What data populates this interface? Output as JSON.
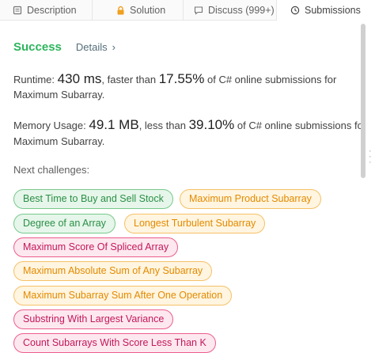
{
  "tabs": {
    "description": "Description",
    "solution": "Solution",
    "discuss": "Discuss (999+)",
    "submissions": "Submissions"
  },
  "result": {
    "status": "Success",
    "details": "Details",
    "runtime_label": "Runtime:",
    "runtime_value": "430 ms",
    "runtime_middle": ", faster than",
    "runtime_percent": "17.55%",
    "runtime_suffix": "of C# online submissions for",
    "runtime_problem": "Maximum Subarray.",
    "memory_label": "Memory Usage:",
    "memory_value": "49.1 MB",
    "memory_middle": ", less than",
    "memory_percent": "39.10%",
    "memory_suffix": "of C# online submissions fo",
    "memory_problem": "Maximum Subarray."
  },
  "next": {
    "label": "Next challenges:",
    "items": [
      {
        "label": "Best Time to Buy and Sell Stock",
        "difficulty": "easy"
      },
      {
        "label": "Maximum Product Subarray",
        "difficulty": "medium"
      },
      {
        "label": "Degree of an Array",
        "difficulty": "easy"
      },
      {
        "label": "Longest Turbulent Subarray",
        "difficulty": "medium"
      },
      {
        "label": "Maximum Score Of Spliced Array",
        "difficulty": "hard"
      },
      {
        "label": "Maximum Absolute Sum of Any Subarray",
        "difficulty": "medium"
      },
      {
        "label": "Maximum Subarray Sum After One Operation",
        "difficulty": "medium"
      },
      {
        "label": "Substring With Largest Variance",
        "difficulty": "hard"
      },
      {
        "label": "Count Subarrays With Score Less Than K",
        "difficulty": "hard"
      }
    ]
  },
  "colors": {
    "success": "#2db55d",
    "easy": "#2a8f46",
    "medium": "#e38a00",
    "hard": "#c4175a"
  },
  "icons": [
    "document-icon",
    "lock-icon",
    "discuss-icon",
    "clock-icon"
  ]
}
